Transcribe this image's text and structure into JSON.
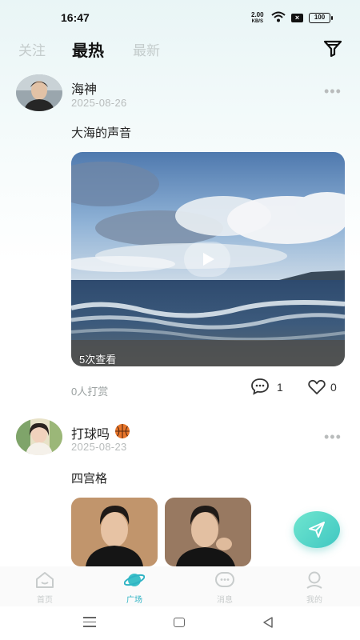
{
  "status_bar": {
    "time": "16:47",
    "net_speed": "2.00",
    "net_unit": "KB/S",
    "battery": "100"
  },
  "tabs": [
    {
      "label": "关注",
      "active": false
    },
    {
      "label": "最热",
      "active": true
    },
    {
      "label": "最新",
      "active": false
    }
  ],
  "posts": [
    {
      "username": "海神",
      "date": "2025-08-26",
      "text": "大海的声音",
      "media_type": "video",
      "views": "5次查看",
      "reward": "0人打赏",
      "comments": "1",
      "likes": "0"
    },
    {
      "username": "打球吗",
      "username_emoji": "basketball-icon",
      "date": "2025-08-23",
      "text": "四宫格",
      "media_type": "image-grid"
    }
  ],
  "bottom_nav": [
    {
      "label": "首页",
      "icon": "home-icon",
      "active": false
    },
    {
      "label": "广场",
      "icon": "planet-icon",
      "active": true
    },
    {
      "label": "消息",
      "icon": "message-icon",
      "active": false
    },
    {
      "label": "我的",
      "icon": "profile-icon",
      "active": false
    }
  ],
  "colors": {
    "accent": "#2fb3c4",
    "fab_start": "#6fe6cf",
    "fab_end": "#40c7c2",
    "inactive": "#c8cccc"
  }
}
